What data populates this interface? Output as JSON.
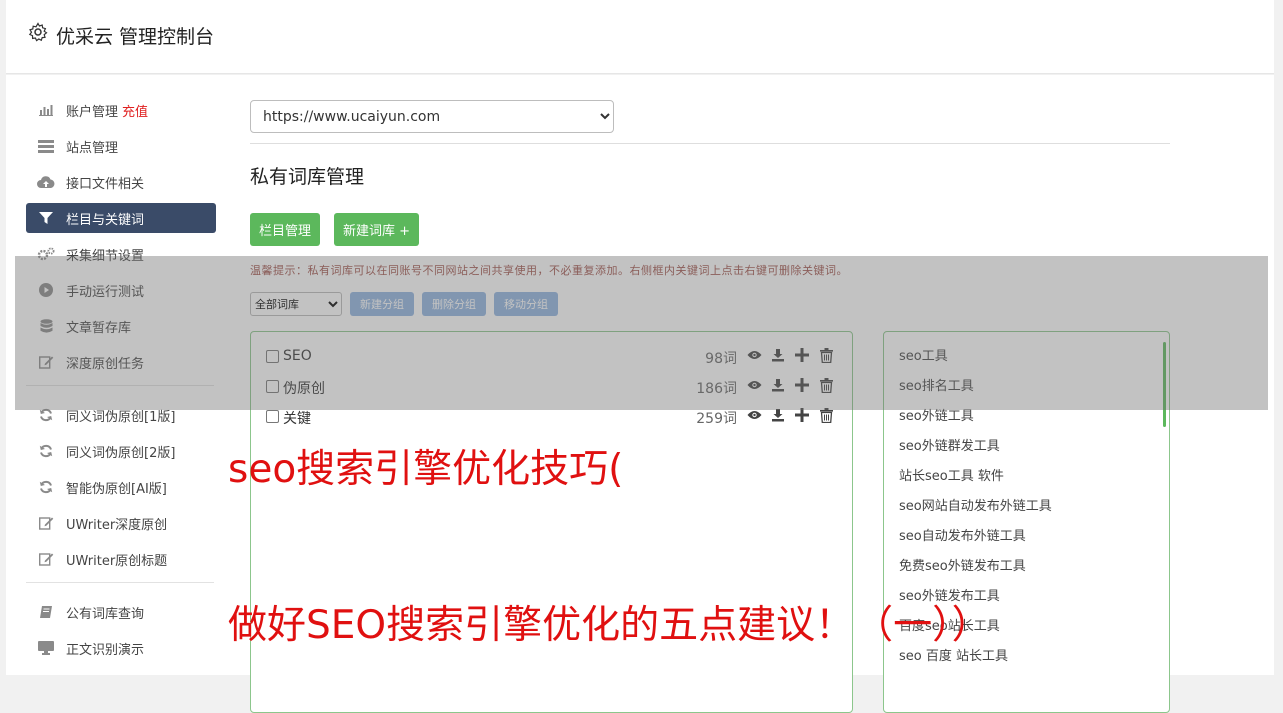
{
  "header": {
    "title": "优采云 管理控制台"
  },
  "sidebar": {
    "items": [
      {
        "label": "账户管理",
        "accent": "充值",
        "icon": "bar-chart-icon"
      },
      {
        "label": "站点管理",
        "icon": "server-icon"
      },
      {
        "label": "接口文件相关",
        "icon": "cloud-upload-icon"
      },
      {
        "label": "栏目与关键词",
        "icon": "filter-icon",
        "active": true
      },
      {
        "label": "采集细节设置",
        "icon": "gears-icon"
      },
      {
        "label": "手动运行测试",
        "icon": "play-circle-icon"
      },
      {
        "label": "文章暂存库",
        "icon": "database-icon"
      },
      {
        "label": "深度原创任务",
        "icon": "edit-icon"
      }
    ],
    "items2": [
      {
        "label": "同义词伪原创[1版]",
        "icon": "refresh-icon"
      },
      {
        "label": "同义词伪原创[2版]",
        "icon": "refresh-icon"
      },
      {
        "label": "智能伪原创[AI版]",
        "icon": "refresh-icon"
      },
      {
        "label": "UWriter深度原创",
        "icon": "edit-icon"
      },
      {
        "label": "UWriter原创标题",
        "icon": "edit-icon"
      }
    ],
    "items3": [
      {
        "label": "公有词库查询",
        "icon": "book-icon"
      },
      {
        "label": "正文识别演示",
        "icon": "monitor-icon"
      }
    ]
  },
  "site_select": {
    "value": "https://www.ucaiyun.com"
  },
  "main": {
    "section_title": "私有词库管理",
    "btn_columns": "栏目管理",
    "btn_new_lib": "新建词库 +",
    "tip": "温馨提示：私有词库可以在同账号不同网站之间共享使用，不必重复添加。右侧框内关键词上点击右键可删除关键词。",
    "lib_filter": "全部词库",
    "btn_new_group": "新建分组",
    "btn_delete_group": "删除分组",
    "btn_move_group": "移动分组"
  },
  "libraries": [
    {
      "name": "SEO",
      "count": "98词"
    },
    {
      "name": "伪原创",
      "count": "186词"
    },
    {
      "name": "关键",
      "count": "259词"
    }
  ],
  "keywords": [
    "seo工具",
    "seo排名工具",
    "seo外链工具",
    "seo外链群发工具",
    "站长seo工具 软件",
    "seo网站自动发布外链工具",
    "seo自动发布外链工具",
    "免费seo外链发布工具",
    "seo外链发布工具",
    "百度seo站长工具",
    "seo 百度 站长工具"
  ],
  "overlay": {
    "line1": "seo搜索引擎优化技巧(",
    "line2": "做好SEO搜索引擎优化的五点建议！（一））"
  },
  "colors": {
    "accent_green": "#5cb85c",
    "nav_active": "#3a4b68",
    "headline_red": "#e01010"
  }
}
